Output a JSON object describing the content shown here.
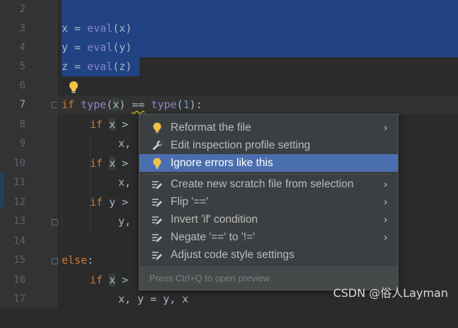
{
  "editor": {
    "line_numbers": [
      "2",
      "3",
      "4",
      "5",
      "6",
      "7",
      "8",
      "9",
      "10",
      "11",
      "12",
      "13",
      "14",
      "15",
      "16",
      "17"
    ],
    "code": {
      "l3_var": "x",
      "l3_eq": " = ",
      "l3_fn": "eval",
      "l3_arg": "(x)",
      "l4_var": "y",
      "l4_eq": " = ",
      "l4_fn": "eval",
      "l4_arg": "(y)",
      "l5_var": "z",
      "l5_eq": " = ",
      "l5_fn": "eval",
      "l5_arg": "(z)",
      "l7_if": "if",
      "l7_sp1": " ",
      "l7_type1": "type",
      "l7_p1": "(",
      "l7_x": "x",
      "l7_p2": ") ",
      "l7_op": "==",
      "l7_sp2": " ",
      "l7_type2": "type",
      "l7_p3": "(",
      "l7_num": "1",
      "l7_p4": "):",
      "l8_if": "if",
      "l8_rest_a": " ",
      "l8_x": "x",
      "l8_rest_b": " >",
      "l9_text": "x,",
      "l10_if": "if",
      "l10_rest_a": " ",
      "l10_x": "x",
      "l10_rest_b": " >",
      "l11_text": "x,",
      "l12_if": "if",
      "l12_rest": " y >",
      "l13_text": "y,",
      "l15_else": "else",
      "l15_colon": ":",
      "l16_if": "if",
      "l16_rest_a": " ",
      "l16_x": "x",
      "l16_rest_b": " >",
      "l17_text": "x, y = y, x"
    }
  },
  "popup": {
    "items": [
      {
        "label": "Reformat the file",
        "icon": "lightbulb-icon",
        "submenu": true
      },
      {
        "label": "Edit inspection profile setting",
        "icon": "wrench-icon",
        "submenu": false
      },
      {
        "label": "Ignore errors like this",
        "icon": "lightbulb-icon",
        "submenu": false,
        "selected": true
      },
      {
        "label": "Create new scratch file from selection",
        "icon": "intention-icon",
        "submenu": true
      },
      {
        "label": "Flip '=='",
        "icon": "intention-icon",
        "submenu": true
      },
      {
        "label": "Invert 'if' condition",
        "icon": "intention-icon",
        "submenu": true
      },
      {
        "label": "Negate '==' to '!='",
        "icon": "intention-icon",
        "submenu": true
      },
      {
        "label": "Adjust code style settings",
        "icon": "intention-icon",
        "submenu": false
      }
    ],
    "chevron": "›",
    "footer": "Press Ctrl+Q to open preview"
  },
  "watermark": "CSDN @俗人Layman",
  "colors": {
    "selection": "#214283",
    "menu_selected": "#4b6eaf",
    "bulb": "#f0c14b"
  }
}
